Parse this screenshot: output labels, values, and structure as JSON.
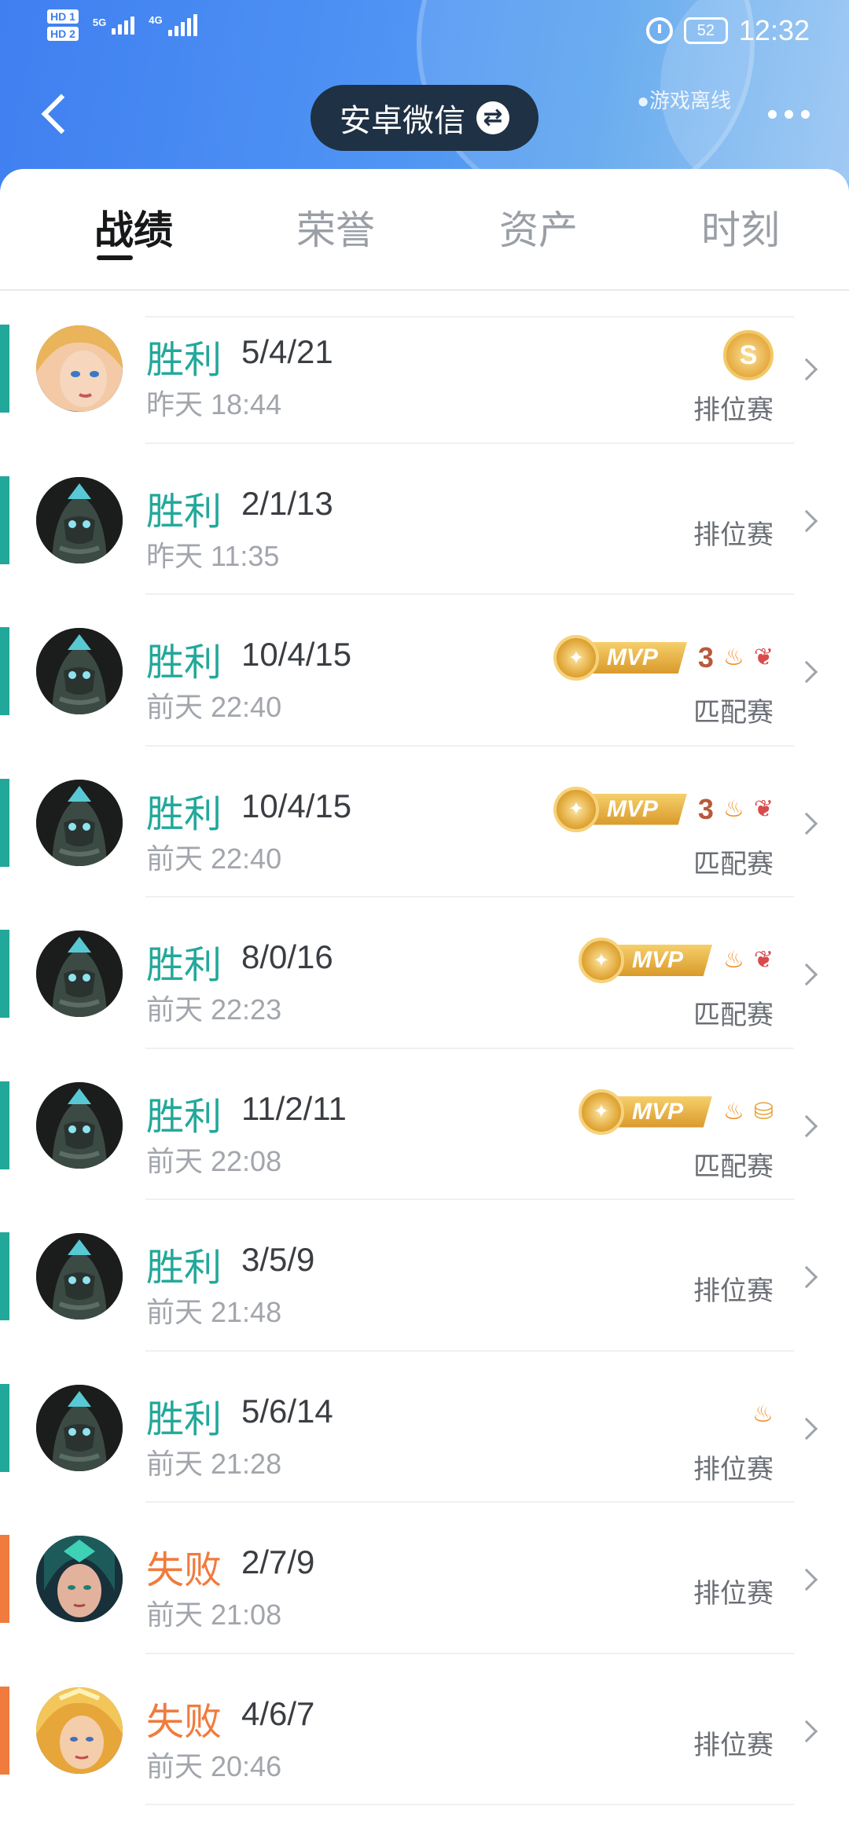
{
  "status_bar": {
    "network_1": "HD 1",
    "network_2": "HD 2",
    "signal_1": "5G",
    "signal_2": "4G",
    "battery": "52",
    "time": "12:32"
  },
  "header": {
    "account_label": "安卓微信",
    "offline_text": "●游戏离线",
    "back_icon": "chevron-left-icon",
    "more_icon": "more-dots-icon"
  },
  "tabs": [
    {
      "label": "战绩",
      "active": true
    },
    {
      "label": "荣誉",
      "active": false
    },
    {
      "label": "资产",
      "active": false
    },
    {
      "label": "时刻",
      "active": false
    }
  ],
  "matches": [
    {
      "result": "胜利",
      "outcome": "win",
      "kda": "5/4/21",
      "time": "昨天 18:44",
      "mode": "排位赛",
      "hero": "blonde-heroine",
      "badges": [
        "s-coin"
      ]
    },
    {
      "result": "胜利",
      "outcome": "win",
      "kda": "2/1/13",
      "time": "昨天 11:35",
      "mode": "排位赛",
      "hero": "dark-armored-hero",
      "badges": []
    },
    {
      "result": "胜利",
      "outcome": "win",
      "kda": "10/4/15",
      "time": "前天 22:40",
      "mode": "匹配赛",
      "hero": "dark-armored-hero",
      "badges": [
        "mvp",
        "triple-kill",
        "fire",
        "lotus"
      ]
    },
    {
      "result": "胜利",
      "outcome": "win",
      "kda": "10/4/15",
      "time": "前天 22:40",
      "mode": "匹配赛",
      "hero": "dark-armored-hero",
      "badges": [
        "mvp",
        "triple-kill",
        "fire",
        "lotus"
      ]
    },
    {
      "result": "胜利",
      "outcome": "win",
      "kda": "8/0/16",
      "time": "前天 22:23",
      "mode": "匹配赛",
      "hero": "dark-armored-hero",
      "badges": [
        "mvp",
        "fire",
        "lotus"
      ]
    },
    {
      "result": "胜利",
      "outcome": "win",
      "kda": "11/2/11",
      "time": "前天 22:08",
      "mode": "匹配赛",
      "hero": "dark-armored-hero",
      "badges": [
        "mvp",
        "fire",
        "coins"
      ]
    },
    {
      "result": "胜利",
      "outcome": "win",
      "kda": "3/5/9",
      "time": "前天 21:48",
      "mode": "排位赛",
      "hero": "dark-armored-hero",
      "badges": []
    },
    {
      "result": "胜利",
      "outcome": "win",
      "kda": "5/6/14",
      "time": "前天 21:28",
      "mode": "排位赛",
      "hero": "dark-armored-hero",
      "badges": [
        "fire"
      ]
    },
    {
      "result": "失败",
      "outcome": "lose",
      "kda": "2/7/9",
      "time": "前天 21:08",
      "mode": "排位赛",
      "hero": "green-mage-heroine",
      "badges": []
    },
    {
      "result": "失败",
      "outcome": "lose",
      "kda": "4/6/7",
      "time": "前天 20:46",
      "mode": "排位赛",
      "hero": "golden-heroine",
      "badges": []
    }
  ],
  "badge_text": {
    "mvp": "MVP",
    "triple": "3",
    "s": "S"
  },
  "colors": {
    "win": "#22a89a",
    "lose": "#f07b3d",
    "header_blue": "#3f7ff0"
  }
}
